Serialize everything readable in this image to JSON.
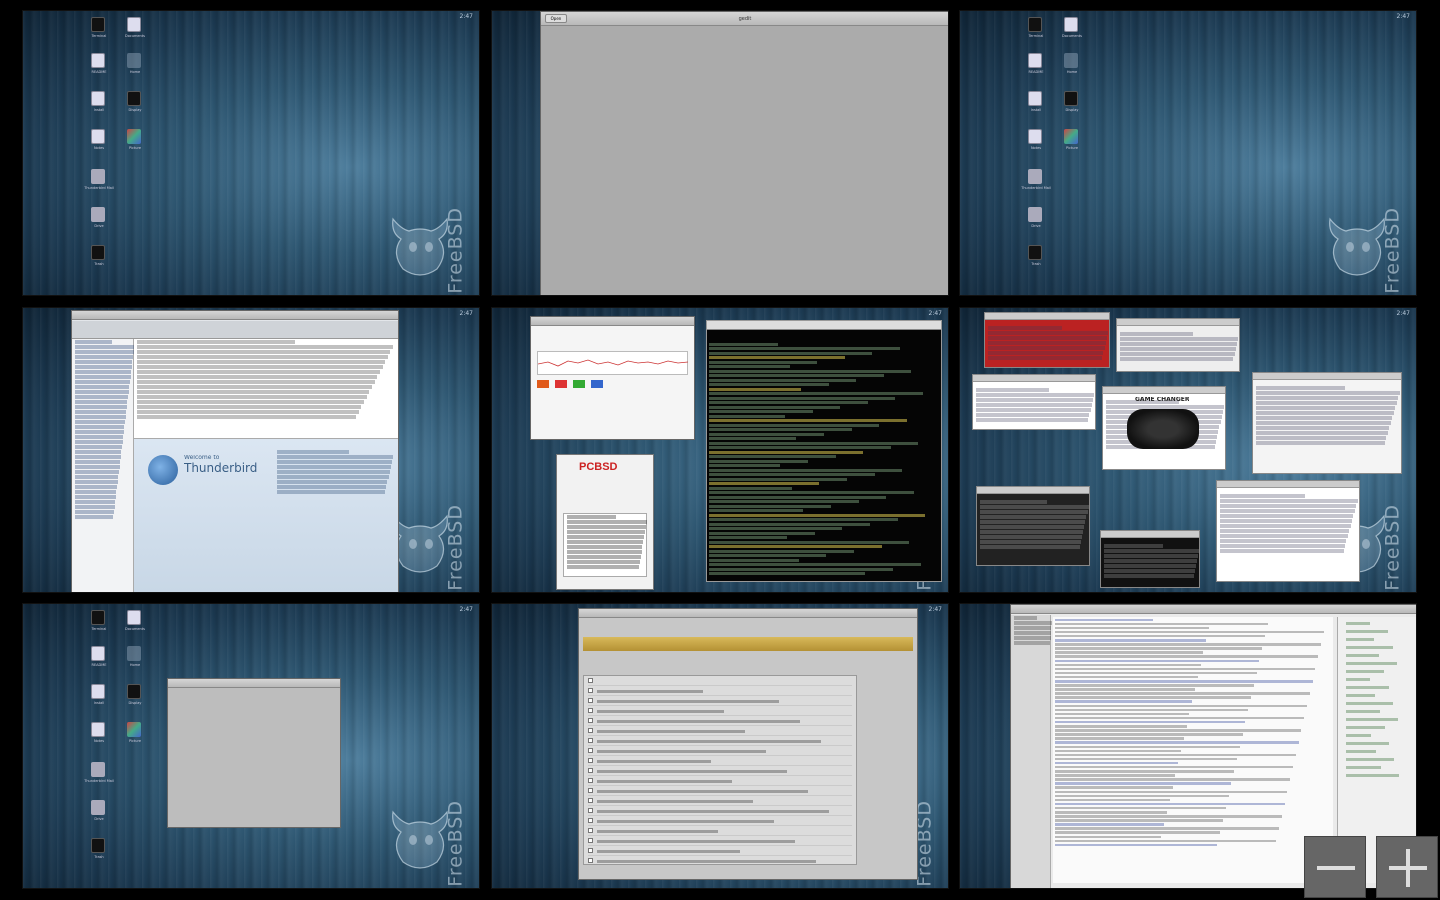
{
  "workspace_grid": {
    "columns": 3,
    "rows": 3,
    "workspaces": [
      {
        "index": 1,
        "kind": "desktop"
      },
      {
        "index": 2,
        "kind": "gedit-window"
      },
      {
        "index": 3,
        "kind": "desktop"
      },
      {
        "index": 4,
        "kind": "thunderbird-window"
      },
      {
        "index": 5,
        "kind": "terminal-and-system-monitor"
      },
      {
        "index": 6,
        "kind": "browser-windows"
      },
      {
        "index": 7,
        "kind": "small-window"
      },
      {
        "index": 8,
        "kind": "settings-window"
      },
      {
        "index": 9,
        "kind": "irc-log-window"
      }
    ]
  },
  "desktop": {
    "brand_text": "FreeBSD",
    "clock": "2:47",
    "icons": [
      {
        "name": "terminal-icon",
        "label": "Terminal"
      },
      {
        "name": "document-icon",
        "label": "Documents"
      },
      {
        "name": "document-icon",
        "label": "README"
      },
      {
        "name": "folder-icon",
        "label": "Home"
      },
      {
        "name": "document-icon",
        "label": "Install"
      },
      {
        "name": "monitor-icon",
        "label": "Display"
      },
      {
        "name": "document-icon",
        "label": "Notes"
      },
      {
        "name": "image-icon",
        "label": "Picture"
      },
      {
        "name": "application-icon",
        "label": "Thunderbird Mail"
      },
      {
        "name": "drive-icon",
        "label": "Drive"
      },
      {
        "name": "trash-icon",
        "label": "Trash"
      }
    ]
  },
  "windows": {
    "gedit": {
      "title": "gedit",
      "open_label": "Open"
    },
    "thunderbird": {
      "welcome_prefix": "Welcome to",
      "app_name": "Thunderbird"
    },
    "pcbsd_logo": "PCBSD",
    "game_changer": "GAME CHANGER"
  },
  "zoom_controls": {
    "zoom_out_icon": "minus-icon",
    "zoom_in_icon": "plus-icon"
  },
  "colors": {
    "background": "#000000",
    "desktop_blue": "#2e5772",
    "window_grey": "#c9c9c9",
    "terminal_bg": "#050505"
  }
}
